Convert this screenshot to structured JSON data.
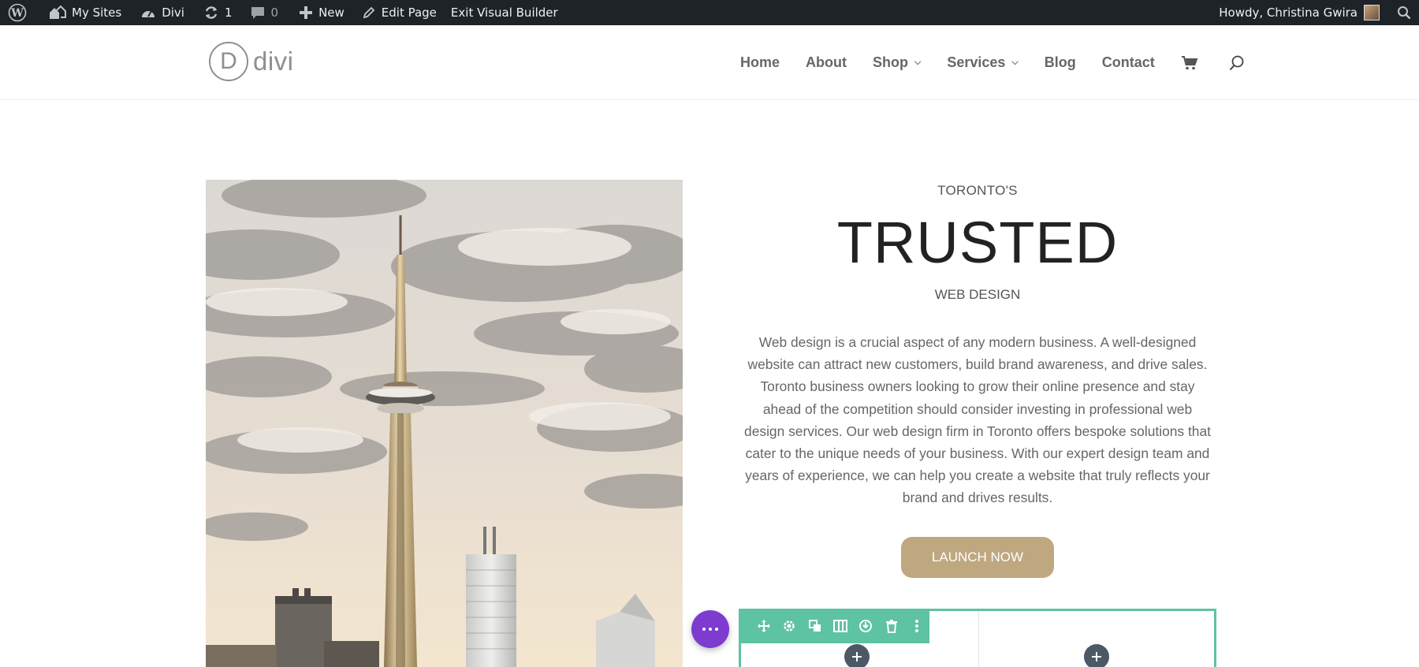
{
  "adminbar": {
    "items": [
      {
        "id": "wp",
        "icon": "wordpress-icon",
        "label": ""
      },
      {
        "id": "my-sites",
        "icon": "my-sites-icon",
        "label": "My Sites"
      },
      {
        "id": "divi",
        "icon": "dashboard-icon",
        "label": "Divi"
      },
      {
        "id": "updates",
        "icon": "updates-icon",
        "label": "1"
      },
      {
        "id": "comments",
        "icon": "comment-icon",
        "label": "0"
      },
      {
        "id": "new",
        "icon": "plus-icon",
        "label": "New"
      },
      {
        "id": "edit-page",
        "icon": "pencil-icon",
        "label": "Edit Page"
      },
      {
        "id": "exit-vb",
        "icon": "",
        "label": "Exit Visual Builder"
      }
    ],
    "greeting": "Howdy, Christina Gwira",
    "search_icon": "search-icon",
    "bg_color": "#1d2327"
  },
  "header": {
    "logo_letter": "D",
    "logo_text": "divi",
    "nav": [
      {
        "label": "Home",
        "has_dropdown": false
      },
      {
        "label": "About",
        "has_dropdown": false
      },
      {
        "label": "Shop",
        "has_dropdown": true
      },
      {
        "label": "Services",
        "has_dropdown": true
      },
      {
        "label": "Blog",
        "has_dropdown": false
      },
      {
        "label": "Contact",
        "has_dropdown": false
      }
    ],
    "cart_icon": "cart-icon",
    "search_icon": "search-icon"
  },
  "hero": {
    "image": "toronto-skyline-cn-tower",
    "pretitle": "TORONTO'S",
    "title": "TRUSTED",
    "subtitle": "WEB DESIGN",
    "body": "Web design is a crucial aspect of any modern business. A well-designed website can attract new customers, build brand awareness, and drive sales. Toronto business owners looking to grow their online presence and stay ahead of the competition should consider investing in professional web design services. Our web design firm in Toronto offers bespoke solutions that cater to the unique needs of your business. With our expert design team and years of experience, we can help you create a website that truly reflects your brand and drives results.",
    "button_label": "LAUNCH NOW",
    "button_color": "#bfa77f"
  },
  "builder": {
    "accent_color": "#5ec2a4",
    "fab_color": "#7d3bcf",
    "row_tools": [
      "move-icon",
      "settings-icon",
      "duplicate-icon",
      "columns-icon",
      "save-icon",
      "delete-icon",
      "more-icon"
    ]
  }
}
